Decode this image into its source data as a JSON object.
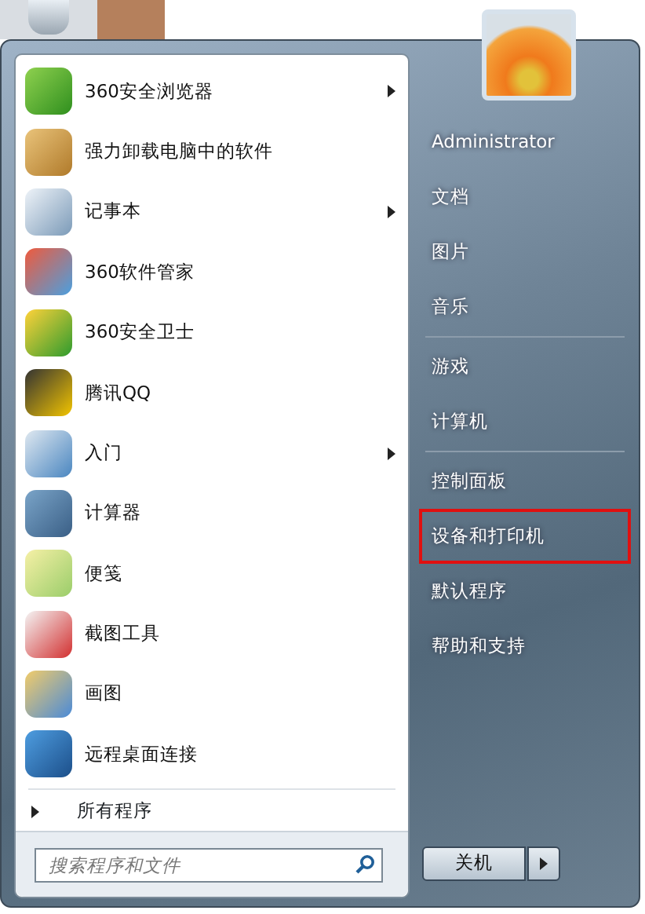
{
  "programs": [
    {
      "label": "360安全浏览器",
      "has_submenu": true
    },
    {
      "label": "强力卸载电脑中的软件",
      "has_submenu": false
    },
    {
      "label": "记事本",
      "has_submenu": true
    },
    {
      "label": "360软件管家",
      "has_submenu": false
    },
    {
      "label": "360安全卫士",
      "has_submenu": false
    },
    {
      "label": "腾讯QQ",
      "has_submenu": false
    },
    {
      "label": "入门",
      "has_submenu": true
    },
    {
      "label": "计算器",
      "has_submenu": false
    },
    {
      "label": "便笺",
      "has_submenu": false
    },
    {
      "label": "截图工具",
      "has_submenu": false
    },
    {
      "label": "画图",
      "has_submenu": false
    },
    {
      "label": "远程桌面连接",
      "has_submenu": false
    }
  ],
  "all_programs": "所有程序",
  "search": {
    "placeholder": "搜索程序和文件"
  },
  "places": [
    {
      "label": "Administrator",
      "highlighted": false,
      "separator_after": false
    },
    {
      "label": "文档",
      "highlighted": false,
      "separator_after": false
    },
    {
      "label": "图片",
      "highlighted": false,
      "separator_after": false
    },
    {
      "label": "音乐",
      "highlighted": false,
      "separator_after": true
    },
    {
      "label": "游戏",
      "highlighted": false,
      "separator_after": false
    },
    {
      "label": "计算机",
      "highlighted": false,
      "separator_after": true
    },
    {
      "label": "控制面板",
      "highlighted": false,
      "separator_after": false
    },
    {
      "label": "设备和打印机",
      "highlighted": true,
      "separator_after": false
    },
    {
      "label": "默认程序",
      "highlighted": false,
      "separator_after": false
    },
    {
      "label": "帮助和支持",
      "highlighted": false,
      "separator_after": false
    }
  ],
  "shutdown": {
    "label": "关机"
  }
}
